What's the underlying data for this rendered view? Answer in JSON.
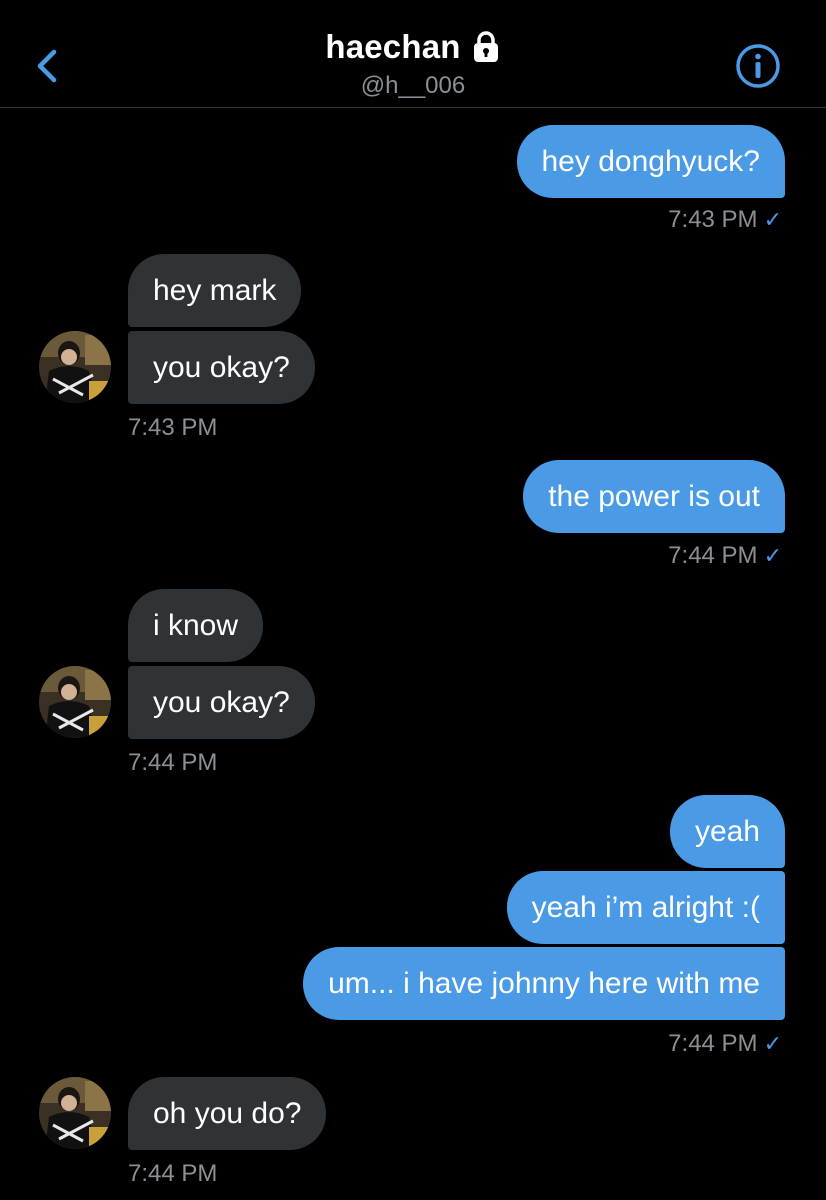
{
  "header": {
    "title": "haechan",
    "handle": "@h__006"
  },
  "colors": {
    "accent": "#4a9ae6",
    "incoming_bubble": "#2f3336",
    "background": "#000000",
    "muted_text": "#8b9096"
  },
  "icons": {
    "back": "chevron-left-icon",
    "lock": "lock-icon",
    "info": "info-icon",
    "read": "check-icon"
  },
  "messages": [
    {
      "direction": "out",
      "text": "hey donghyuck?"
    },
    {
      "direction": "in",
      "text": "hey mark"
    },
    {
      "direction": "in",
      "text": "you okay?"
    },
    {
      "direction": "out",
      "text": "the power is out"
    },
    {
      "direction": "in",
      "text": "i know"
    },
    {
      "direction": "in",
      "text": "you okay?"
    },
    {
      "direction": "out",
      "text": "yeah"
    },
    {
      "direction": "out",
      "text": "yeah i’m alright :("
    },
    {
      "direction": "out",
      "text": "um... i have johnny here with me"
    },
    {
      "direction": "in",
      "text": "oh you do?"
    }
  ],
  "timestamps": [
    {
      "text": "7:43 PM",
      "read_mark": "✓"
    },
    {
      "text": "7:43 PM"
    },
    {
      "text": "7:44 PM",
      "read_mark": "✓"
    },
    {
      "text": "7:44 PM"
    },
    {
      "text": "7:44 PM",
      "read_mark": "✓"
    },
    {
      "text": "7:44 PM"
    }
  ]
}
